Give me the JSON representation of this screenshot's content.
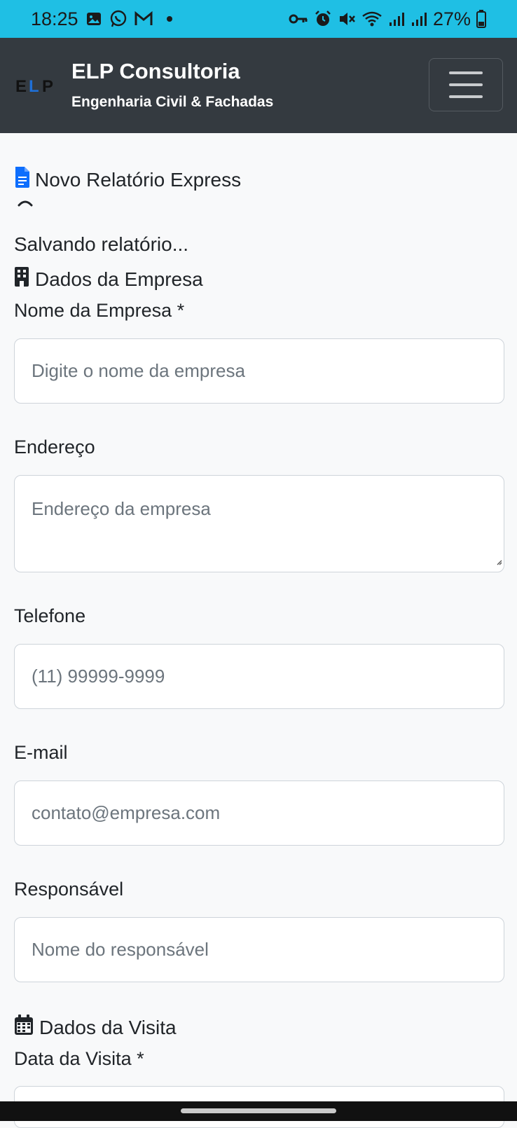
{
  "status_bar": {
    "time": "18:25",
    "battery": "27%",
    "left_icons": [
      "image-icon",
      "whatsapp-icon",
      "gmail-icon",
      "dot-icon"
    ],
    "right_icons": [
      "key-icon",
      "alarm-icon",
      "mute-icon",
      "wifi-icon",
      "signal-icon",
      "signal-icon",
      "battery-icon"
    ]
  },
  "navbar": {
    "logo_text": "ELP",
    "title": "ELP Consultoria",
    "subtitle": "Engenharia Civil & Fachadas",
    "menu_icon": "hamburger-icon"
  },
  "page": {
    "title": "Novo Relatório Express",
    "saving_text": "Salvando relatório...",
    "sections": {
      "company": "Dados da Empresa",
      "visit": "Dados da Visita"
    },
    "fields": {
      "company_name": {
        "label": "Nome da Empresa *",
        "placeholder": "Digite o nome da empresa"
      },
      "address": {
        "label": "Endereço",
        "placeholder": "Endereço da empresa"
      },
      "phone": {
        "label": "Telefone",
        "placeholder": "(11) 99999-9999"
      },
      "email": {
        "label": "E-mail",
        "placeholder": "contato@empresa.com"
      },
      "responsible": {
        "label": "Responsável",
        "placeholder": "Nome do responsável"
      },
      "visit_date": {
        "label": "Data da Visita *",
        "placeholder": ""
      }
    }
  },
  "colors": {
    "status_bar": "#1fbfe4",
    "navbar": "#343a40",
    "accent": "#0d6efd",
    "background": "#f8f9fa"
  }
}
